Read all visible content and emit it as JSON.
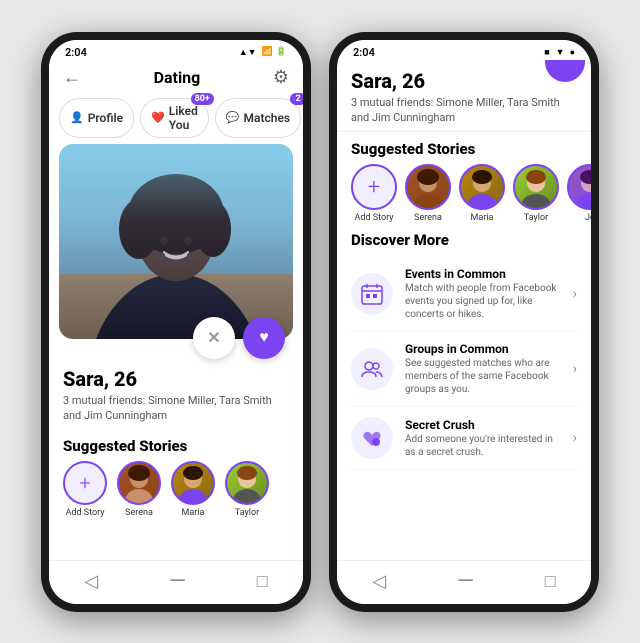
{
  "phone1": {
    "status_bar": {
      "time": "2:04",
      "signal": "▲",
      "wifi": "▼",
      "battery": "🔋"
    },
    "header": {
      "back_label": "←",
      "title": "Dating",
      "gear_label": "⚙"
    },
    "tabs": [
      {
        "id": "profile",
        "label": "Profile",
        "icon": "👤",
        "badge": null
      },
      {
        "id": "liked-you",
        "label": "Liked You",
        "icon": "❤",
        "badge": "80+"
      },
      {
        "id": "matches",
        "label": "Matches",
        "icon": "💬",
        "badge": "2"
      }
    ],
    "profile": {
      "name": "Sara, 26",
      "friends": "3 mutual friends: Simone Miller, Tara Smith and Jim Cunningham"
    },
    "action_buttons": {
      "pass_label": "✕",
      "like_label": "♥"
    },
    "suggested_stories": {
      "title": "Suggested Stories",
      "items": [
        {
          "label": "Add Story",
          "type": "add"
        },
        {
          "label": "Serena",
          "type": "avatar",
          "color": "brown"
        },
        {
          "label": "Maria",
          "type": "avatar",
          "color": "tan"
        },
        {
          "label": "Taylor",
          "type": "avatar",
          "color": "olive"
        }
      ]
    },
    "nav": {
      "back": "◁",
      "home": "—",
      "square": "□"
    }
  },
  "phone2": {
    "status_bar": {
      "time": "2:04",
      "icons": "■ ●"
    },
    "profile": {
      "name": "Sara, 26",
      "friends": "3 mutual friends: Simone Miller, Tara Smith and Jim Cunningham"
    },
    "suggested_stories": {
      "title": "Suggested Stories",
      "items": [
        {
          "label": "Add Story",
          "type": "add"
        },
        {
          "label": "Serena",
          "type": "avatar",
          "color": "brown"
        },
        {
          "label": "Maria",
          "type": "avatar",
          "color": "tan"
        },
        {
          "label": "Taylor",
          "type": "avatar",
          "color": "olive"
        },
        {
          "label": "Jo",
          "type": "avatar",
          "color": "purple"
        }
      ]
    },
    "discover_more": {
      "title": "Discover More",
      "items": [
        {
          "id": "events",
          "icon": "⊞",
          "title": "Events in Common",
          "desc": "Match with people from Facebook events you signed up for, like concerts or hikes."
        },
        {
          "id": "groups",
          "icon": "👥",
          "title": "Groups in Common",
          "desc": "See suggested matches who are members of the same Facebook groups as you."
        },
        {
          "id": "secret-crush",
          "icon": "💜",
          "title": "Secret Crush",
          "desc": "Add someone you're interested in as a secret crush."
        }
      ]
    },
    "nav": {
      "back": "◁",
      "home": "—",
      "square": "□"
    }
  }
}
